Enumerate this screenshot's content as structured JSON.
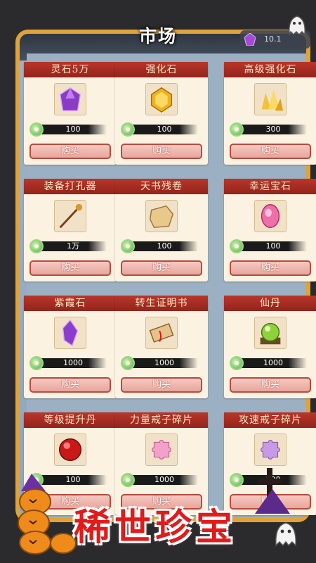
{
  "title": "市场",
  "currency": {
    "icon": "purple-gem-icon",
    "value": "10.1"
  },
  "items": [
    {
      "name": "灵石5万",
      "price": "100",
      "buy": "购买",
      "icon": "purple-crystal-icon"
    },
    {
      "name": "强化石",
      "price": "100",
      "buy": "购买",
      "icon": "gold-gem-icon"
    },
    {
      "name": "高级强化石",
      "price": "300",
      "buy": "购买",
      "icon": "gold-crystal-cluster-icon"
    },
    {
      "name": "装备打孔器",
      "price": "1万",
      "buy": "购买",
      "icon": "drill-tool-icon"
    },
    {
      "name": "天书残卷",
      "price": "100",
      "buy": "购买",
      "icon": "scroll-fragment-icon"
    },
    {
      "name": "幸运宝石",
      "price": "100",
      "buy": "购买",
      "icon": "pink-gem-icon"
    },
    {
      "name": "紫霞石",
      "price": "1000",
      "buy": "购买",
      "icon": "purple-stone-icon"
    },
    {
      "name": "转生证明书",
      "price": "1000",
      "buy": "购买",
      "icon": "scroll-icon"
    },
    {
      "name": "仙丹",
      "price": "1000",
      "buy": "购买",
      "icon": "green-orb-icon"
    },
    {
      "name": "等级提升丹",
      "price": "100",
      "buy": "购买",
      "icon": "red-orb-icon"
    },
    {
      "name": "力量戒子碎片",
      "price": "1000",
      "buy": "购买",
      "icon": "pink-puzzle-icon"
    },
    {
      "name": "攻速戒子碎片",
      "price": "100",
      "buy": "购买",
      "icon": "purple-puzzle-icon"
    }
  ],
  "banner": "稀世珍宝",
  "colors": {
    "accent": "#b8362b",
    "frame": "#e0a33a",
    "banner": "#e11b1b"
  }
}
